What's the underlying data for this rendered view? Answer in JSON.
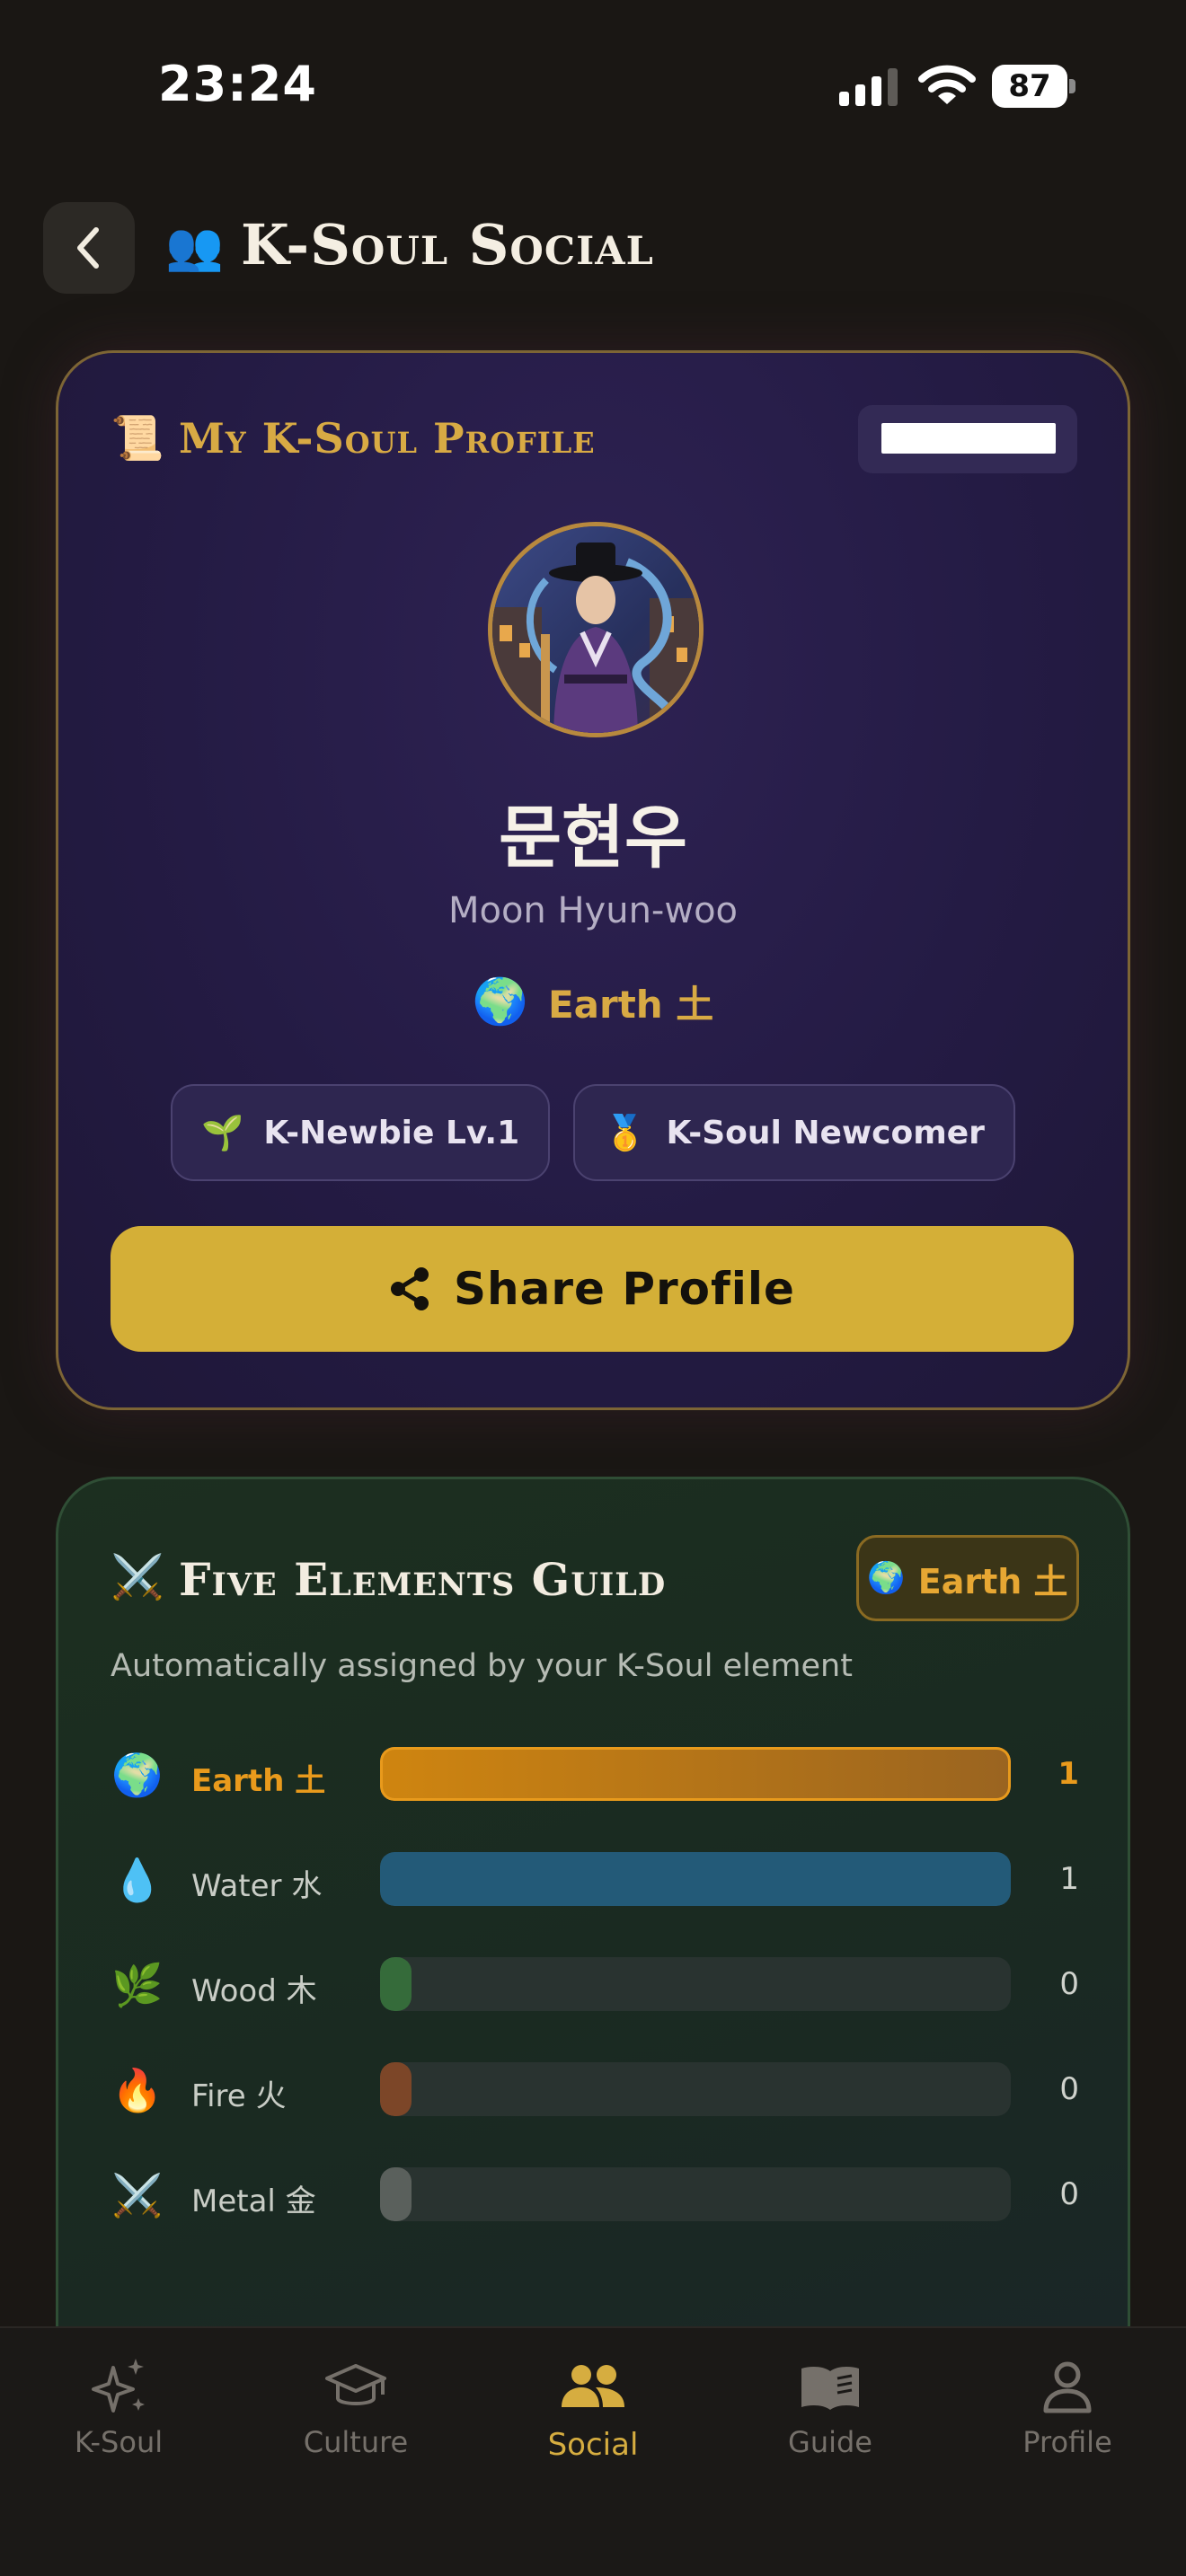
{
  "status_bar": {
    "time": "23:24",
    "battery": "87"
  },
  "header": {
    "title": "K-Soul Social",
    "icon": "👥"
  },
  "profile": {
    "section_title": "My K-Soul Profile",
    "section_icon": "📜",
    "name_kr": "문현우",
    "name_en": "Moon Hyun-woo",
    "element_icon": "🌍",
    "element_label": "Earth 土",
    "badges": [
      {
        "icon": "🌱",
        "label": "K-Newbie Lv.1"
      },
      {
        "icon": "🥇",
        "label": "K-Soul Newcomer"
      }
    ],
    "share_label": "Share Profile"
  },
  "guild": {
    "icon": "⚔️",
    "title": "Five Elements Guild",
    "badge_icon": "🌍",
    "badge_label": "Earth 土",
    "description": "Automatically assigned by your K-Soul element",
    "elements": [
      {
        "icon": "🌍",
        "label": "Earth 土",
        "count": "1",
        "fill": 1.0,
        "color": "#c47d14",
        "active": true
      },
      {
        "icon": "💧",
        "label": "Water 水",
        "count": "1",
        "fill": 1.0,
        "color": "#235a78",
        "active": false
      },
      {
        "icon": "🌿",
        "label": "Wood 木",
        "count": "0",
        "fill": 0.0,
        "color": "#356b3a",
        "active": false
      },
      {
        "icon": "🔥",
        "label": "Fire 火",
        "count": "0",
        "fill": 0.0,
        "color": "#7c4628",
        "active": false
      },
      {
        "icon": "⚔️",
        "label": "Metal 金",
        "count": "0",
        "fill": 0.0,
        "color": "#5a605c",
        "active": false
      }
    ]
  },
  "nav": {
    "items": [
      {
        "label": "K-Soul",
        "icon": "sparkle-icon"
      },
      {
        "label": "Culture",
        "icon": "graduation-cap-icon"
      },
      {
        "label": "Social",
        "icon": "people-icon",
        "active": true
      },
      {
        "label": "Guide",
        "icon": "open-book-icon"
      },
      {
        "label": "Profile",
        "icon": "person-icon"
      }
    ]
  },
  "colors": {
    "gold": "#d4af37",
    "accent_orange": "#e99a1c",
    "background": "#1a1714"
  }
}
